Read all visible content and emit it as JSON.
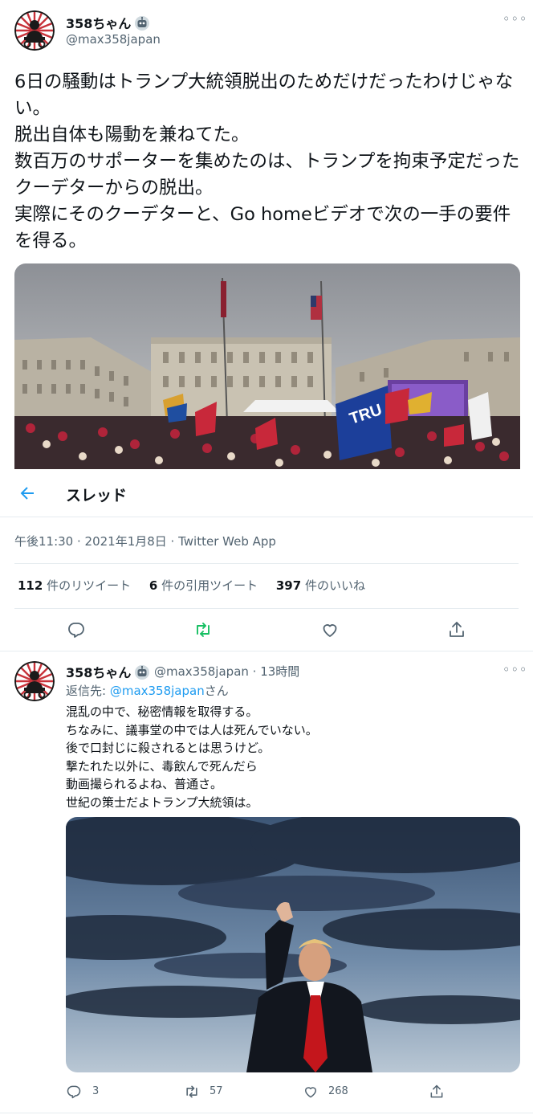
{
  "main_tweet": {
    "display_name": "358ちゃん",
    "handle": "@max358japan",
    "text": "6日の騒動はトランプ大統領脱出のためだけだったわけじゃない。\n脱出自体も陽動を兼ねてた。\n数百万のサポーターを集めたのは、トランプを拘束予定だったクーデターからの脱出。\n実際にそのクーデターと、Go homeビデオで次の一手の要件を得る。",
    "more_label": "◦◦◦",
    "timestamp": "午後11:30 · 2021年1月8日 · Twitter Web App",
    "stats": {
      "retweets_num": "112",
      "retweets_label": " 件のリツイート",
      "quotes_num": "6",
      "quotes_label": " 件の引用ツイート",
      "likes_num": "397",
      "likes_label": " 件のいいね"
    }
  },
  "thread_bar": {
    "title": "スレッド"
  },
  "reply_tweet": {
    "display_name": "358ちゃん",
    "handle_time": "@max358japan · 13時間",
    "replying_prefix": "返信先: ",
    "replying_mention": "@max358japan",
    "replying_suffix": "さん",
    "text": "混乱の中で、秘密情報を取得する。\nちなみに、議事堂の中では人は死んでいない。\n後で口封じに殺されるとは思うけど。\n撃たれた以外に、毒飲んで死んだら\n動画撮られるよね、普通さ。\n世紀の策士だよトランプ大統領は。",
    "more_label": "◦◦◦",
    "counts": {
      "replies": "3",
      "retweets": "57",
      "likes": "268"
    }
  },
  "colors": {
    "accent": "#1d9bf0",
    "retweet_green": "#17bf63",
    "muted": "#536471"
  },
  "icons": [
    "back-arrow-icon",
    "reply-icon",
    "retweet-icon",
    "like-icon",
    "share-icon",
    "robot-badge-icon",
    "more-icon"
  ]
}
